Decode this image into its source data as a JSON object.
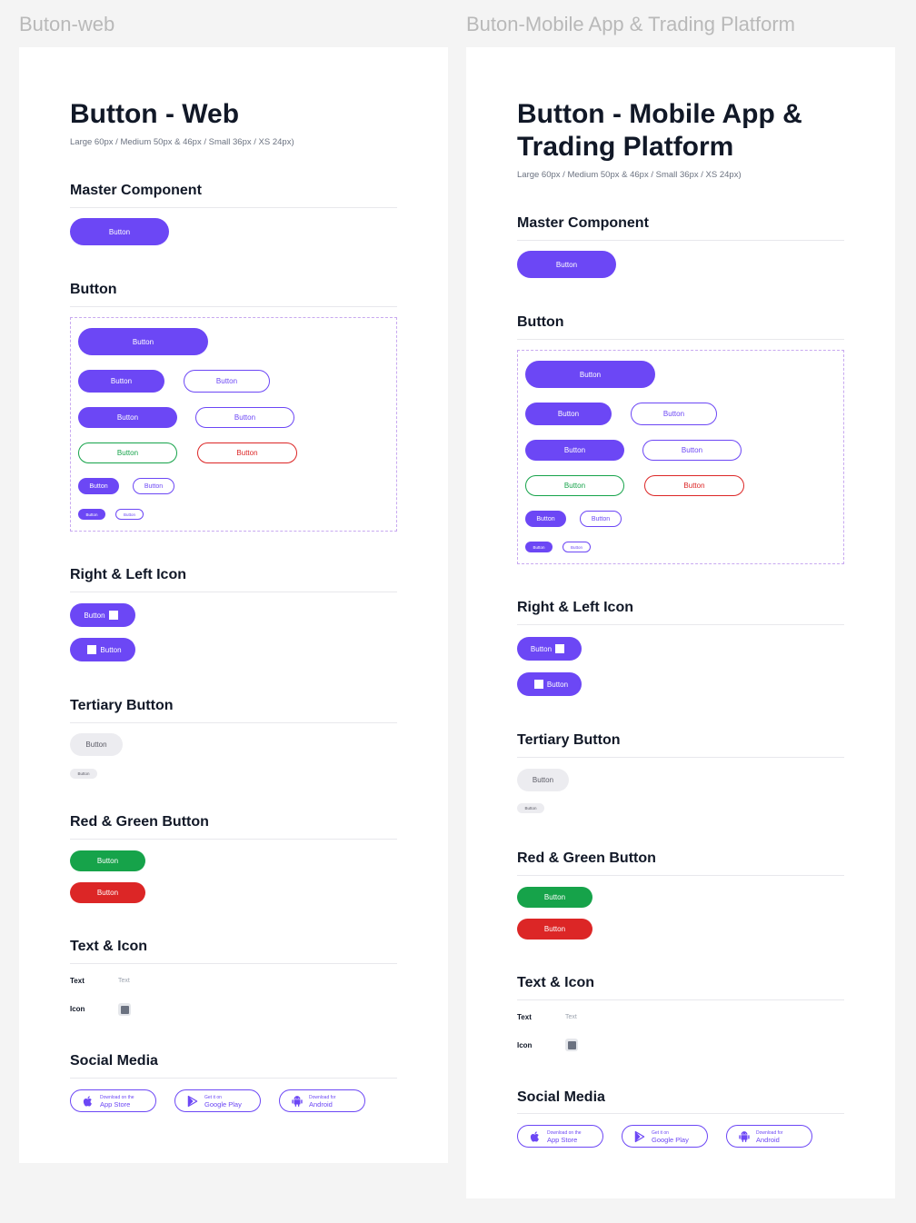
{
  "frames": [
    {
      "label": "Buton-web",
      "title_line1": "Button - Web",
      "title_line2": "",
      "subtitle": "Large 60px / Medium 50px & 46px / Small 36px / XS 24px)"
    },
    {
      "label": "Buton-Mobile App & Trading Platform",
      "title_line1": "Button - Mobile App &",
      "title_line2": "Trading Platform",
      "subtitle": "Large 60px / Medium 50px & 46px / Small 36px / XS 24px)"
    }
  ],
  "sections": {
    "master": "Master Component",
    "button": "Button",
    "icons": "Right & Left Icon",
    "tertiary": "Tertiary Button",
    "redgreen": "Red & Green Button",
    "texticon": "Text & Icon",
    "social": "Social Media"
  },
  "button_label": "Button",
  "text_icon": {
    "text_label": "Text",
    "text_value": "Text",
    "icon_label": "Icon"
  },
  "social": {
    "app_store_small": "Download on the",
    "app_store_big": "App Store",
    "google_small": "Get it on",
    "google_big": "Google Play",
    "android_small": "Download for",
    "android_big": "Android"
  },
  "colors": {
    "primary": "#6C47F5",
    "green": "#16A34A",
    "red": "#DC2626",
    "tertiary": "#ECECF0",
    "dashed_border": "#C8A9F0"
  }
}
